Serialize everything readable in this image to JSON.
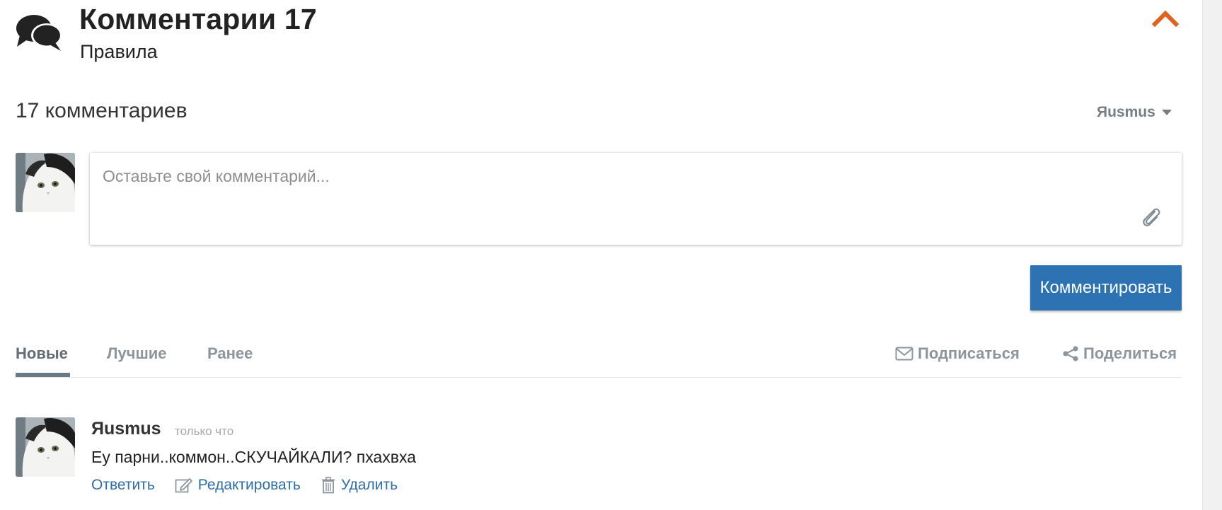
{
  "header": {
    "title": "Комментарии 17",
    "rules_link": "Правила",
    "icon": "comments-icon",
    "collapse_icon": "chevron-up-icon",
    "accent_color": "#e0621d"
  },
  "thread": {
    "count_label": "17 комментариев",
    "user_menu_label": "Яusmus"
  },
  "composer": {
    "placeholder": "Оставьте свой комментарий...",
    "value": "",
    "attach_icon": "paperclip-icon",
    "submit_label": "Комментировать",
    "submit_color": "#2d73b3"
  },
  "tabs": [
    {
      "label": "Новые",
      "active": true
    },
    {
      "label": "Лучшие",
      "active": false
    },
    {
      "label": "Ранее",
      "active": false
    }
  ],
  "actions": {
    "subscribe_label": "Подписаться",
    "subscribe_icon": "envelope-icon",
    "share_label": "Поделиться",
    "share_icon": "share-icon"
  },
  "comments": [
    {
      "author": "Яusmus",
      "time": "только что",
      "body": "Еу парни..коммон..СКУЧАЙКАЛИ? пхахвха",
      "reply_label": "Ответить",
      "edit_label": "Редактировать",
      "edit_icon": "pencil-icon",
      "delete_label": "Удалить",
      "delete_icon": "trash-icon"
    }
  ]
}
